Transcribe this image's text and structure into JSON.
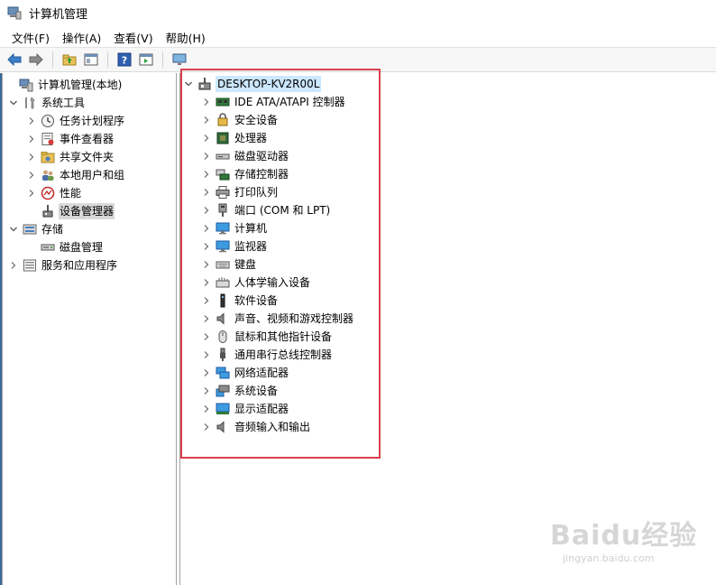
{
  "window": {
    "title": "计算机管理"
  },
  "menu": [
    "文件(F)",
    "操作(A)",
    "查看(V)",
    "帮助(H)"
  ],
  "left_tree": [
    {
      "label": "计算机管理(本地)",
      "icon": "computer-management-icon",
      "depth": 0,
      "chevron": "none"
    },
    {
      "label": "系统工具",
      "icon": "tools-icon",
      "depth": 1,
      "chevron": "expanded"
    },
    {
      "label": "任务计划程序",
      "icon": "clock-icon",
      "depth": 2,
      "chevron": "collapsed"
    },
    {
      "label": "事件查看器",
      "icon": "event-viewer-icon",
      "depth": 2,
      "chevron": "collapsed"
    },
    {
      "label": "共享文件夹",
      "icon": "shared-folder-icon",
      "depth": 2,
      "chevron": "collapsed"
    },
    {
      "label": "本地用户和组",
      "icon": "users-icon",
      "depth": 2,
      "chevron": "collapsed"
    },
    {
      "label": "性能",
      "icon": "performance-icon",
      "depth": 2,
      "chevron": "collapsed"
    },
    {
      "label": "设备管理器",
      "icon": "device-manager-icon",
      "depth": 2,
      "chevron": "none",
      "selected": true
    },
    {
      "label": "存储",
      "icon": "storage-icon",
      "depth": 1,
      "chevron": "expanded"
    },
    {
      "label": "磁盘管理",
      "icon": "disk-management-icon",
      "depth": 2,
      "chevron": "none"
    },
    {
      "label": "服务和应用程序",
      "icon": "services-icon",
      "depth": 1,
      "chevron": "collapsed"
    }
  ],
  "device_tree": {
    "root": {
      "label": "DESKTOP-KV2R00L",
      "icon": "computer-root-icon"
    },
    "items": [
      {
        "label": "IDE ATA/ATAPI 控制器",
        "icon": "ide-controller-icon"
      },
      {
        "label": "安全设备",
        "icon": "security-device-icon"
      },
      {
        "label": "处理器",
        "icon": "processor-icon"
      },
      {
        "label": "磁盘驱动器",
        "icon": "disk-drive-icon"
      },
      {
        "label": "存储控制器",
        "icon": "storage-controller-icon"
      },
      {
        "label": "打印队列",
        "icon": "printer-icon"
      },
      {
        "label": "端口 (COM 和 LPT)",
        "icon": "port-icon"
      },
      {
        "label": "计算机",
        "icon": "computer-icon"
      },
      {
        "label": "监视器",
        "icon": "monitor-icon"
      },
      {
        "label": "键盘",
        "icon": "keyboard-icon"
      },
      {
        "label": "人体学输入设备",
        "icon": "hid-icon"
      },
      {
        "label": "软件设备",
        "icon": "software-device-icon"
      },
      {
        "label": "声音、视频和游戏控制器",
        "icon": "sound-icon"
      },
      {
        "label": "鼠标和其他指针设备",
        "icon": "mouse-icon"
      },
      {
        "label": "通用串行总线控制器",
        "icon": "usb-icon"
      },
      {
        "label": "网络适配器",
        "icon": "network-adapter-icon"
      },
      {
        "label": "系统设备",
        "icon": "system-device-icon"
      },
      {
        "label": "显示适配器",
        "icon": "display-adapter-icon"
      },
      {
        "label": "音频输入和输出",
        "icon": "audio-io-icon"
      }
    ]
  },
  "watermark": {
    "text": "Baidu经验",
    "sub": "jingyan.baidu.com"
  },
  "colors": {
    "highlight_box": "#d9414a",
    "root_selection": "#cce8ff",
    "selection": "#d9d9d9"
  }
}
